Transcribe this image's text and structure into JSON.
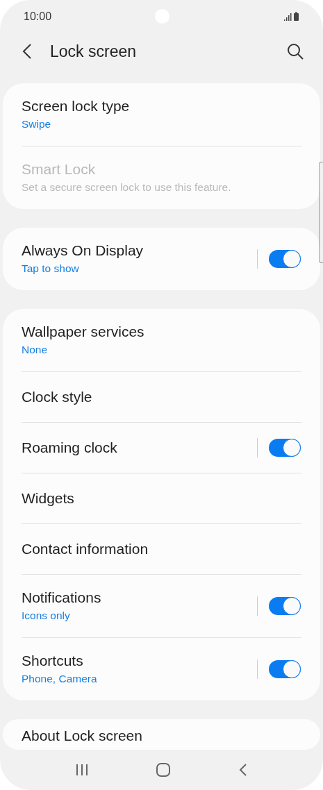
{
  "status_bar": {
    "time": "10:00"
  },
  "header": {
    "title": "Lock screen"
  },
  "cards": [
    {
      "items": [
        {
          "kind": "plain",
          "title": "Screen lock type",
          "subtitle": "Swipe",
          "disabled": false
        },
        {
          "kind": "plain",
          "title": "Smart Lock",
          "subtitle": "Set a secure screen lock to use this feature.",
          "disabled": true
        }
      ]
    },
    {
      "items": [
        {
          "kind": "toggle",
          "title": "Always On Display",
          "subtitle": "Tap to show",
          "disabled": false,
          "on": true
        }
      ]
    },
    {
      "items": [
        {
          "kind": "plain",
          "title": "Wallpaper services",
          "subtitle": "None",
          "disabled": false
        },
        {
          "kind": "plain",
          "title": "Clock style",
          "disabled": false
        },
        {
          "kind": "toggle",
          "title": "Roaming clock",
          "disabled": false,
          "on": true
        },
        {
          "kind": "plain",
          "title": "Widgets",
          "disabled": false
        },
        {
          "kind": "plain",
          "title": "Contact information",
          "disabled": false
        },
        {
          "kind": "toggle",
          "title": "Notifications",
          "subtitle": "Icons only",
          "disabled": false,
          "on": true
        },
        {
          "kind": "toggle",
          "title": "Shortcuts",
          "subtitle": "Phone, Camera",
          "disabled": false,
          "on": true
        }
      ]
    },
    {
      "items": [
        {
          "kind": "plain",
          "title": "About Lock screen",
          "disabled": false
        }
      ]
    }
  ]
}
